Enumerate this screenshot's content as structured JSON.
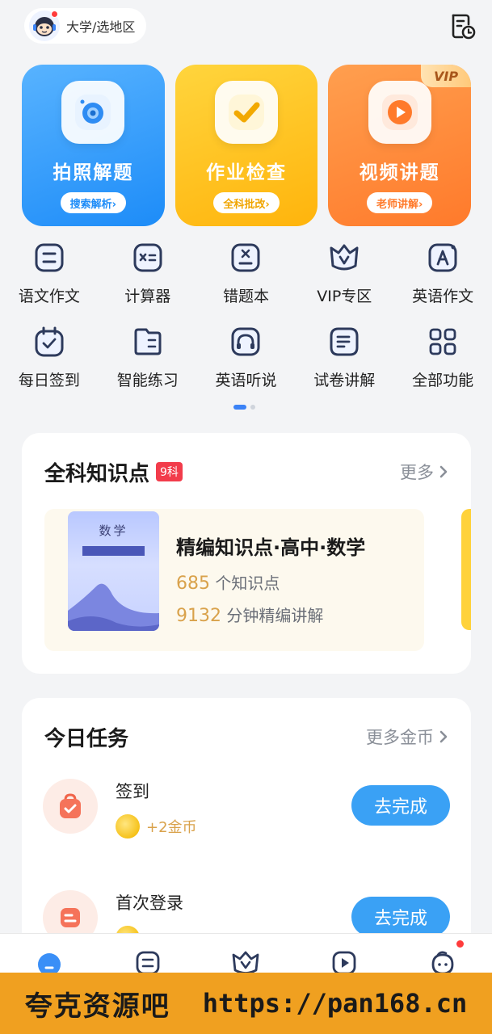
{
  "header": {
    "location_label": "大学/选地区",
    "history_icon": "history-document-icon"
  },
  "big_cards": [
    {
      "title": "拍照解题",
      "sub": "搜索解析›",
      "icon": "camera-icon"
    },
    {
      "title": "作业检查",
      "sub": "全科批改›",
      "icon": "checkmark-icon"
    },
    {
      "title": "视频讲题",
      "sub": "老师讲解›",
      "icon": "play-icon",
      "badge": "VIP"
    }
  ],
  "grid": [
    {
      "label": "语文作文",
      "icon": "essay-icon"
    },
    {
      "label": "计算器",
      "icon": "calculator-icon"
    },
    {
      "label": "错题本",
      "icon": "mistake-book-icon"
    },
    {
      "label": "VIP专区",
      "icon": "vip-icon"
    },
    {
      "label": "英语作文",
      "icon": "english-essay-icon"
    },
    {
      "label": "每日签到",
      "icon": "calendar-check-icon"
    },
    {
      "label": "智能练习",
      "icon": "practice-book-icon"
    },
    {
      "label": "英语听说",
      "icon": "headphones-icon"
    },
    {
      "label": "试卷讲解",
      "icon": "exam-paper-icon"
    },
    {
      "label": "全部功能",
      "icon": "grid-apps-icon"
    }
  ],
  "knowledge": {
    "title": "全科知识点",
    "badge": "9科",
    "more": "更多",
    "card": {
      "cover_title": "数学",
      "name": "精编知识点·高中·数学",
      "points_num": "685",
      "points_text": "个知识点",
      "minutes_num": "9132",
      "minutes_text": "分钟精编讲解"
    }
  },
  "tasks": {
    "title": "今日任务",
    "more": "更多金币",
    "items": [
      {
        "name": "签到",
        "reward": "+2金币",
        "button": "去完成",
        "icon": "checkin-bag-icon"
      },
      {
        "name": "首次登录",
        "reward": "",
        "button": "去完成",
        "icon": "login-icon"
      }
    ]
  },
  "bottom_nav": [
    {
      "icon": "home-icon",
      "active": true
    },
    {
      "icon": "list-icon"
    },
    {
      "icon": "vip-crown-icon"
    },
    {
      "icon": "video-icon"
    },
    {
      "icon": "profile-icon",
      "dot": true
    }
  ],
  "watermark": {
    "left": "夸克资源吧",
    "right": "https://pan168.cn"
  },
  "colors": {
    "blue": "#1d8cf8",
    "yellow": "#ffb40c",
    "orange": "#ff7a2b",
    "button_blue": "#3aa1f5",
    "badge_red": "#f23c4b",
    "watermark_bg": "#f0a020"
  }
}
